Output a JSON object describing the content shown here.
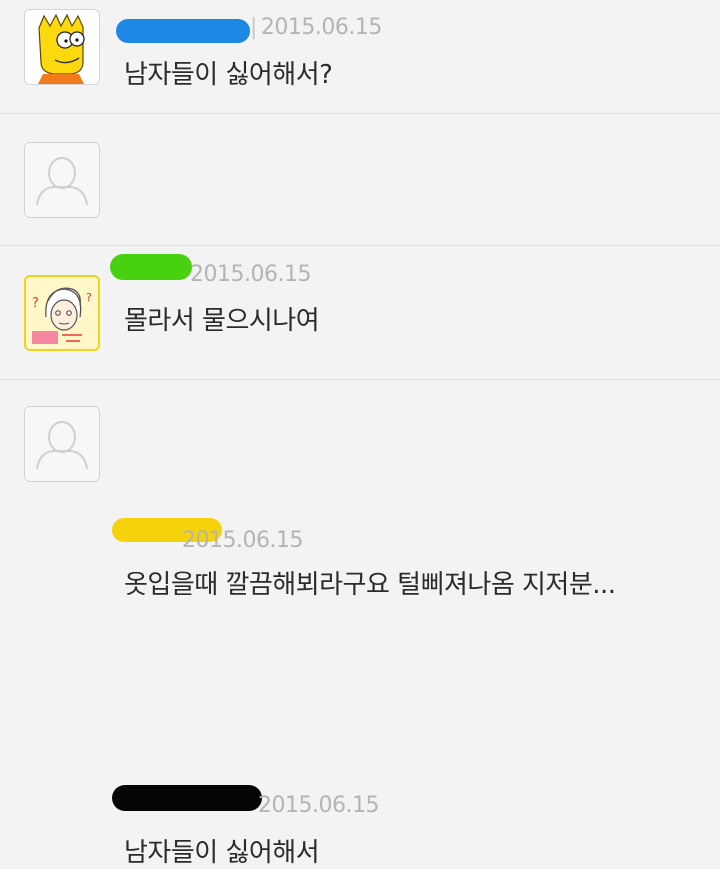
{
  "comments": [
    {
      "date": "2015.06.15",
      "text": "남자들이 싫어해서?",
      "avatar": "bart-simpson-avatar",
      "redact_color": "#1e88e5"
    },
    {
      "date": "2015.06.15",
      "text": "몰라서 물으시나여",
      "avatar": "default-person-icon",
      "redact_color": "#48d10f"
    },
    {
      "date": "2015.06.15",
      "text": "옷입을때 깔끔해뵈라구요 털삐져나옴 지저분...",
      "avatar": "cartoon-face-avatar",
      "redact_color": "#f5d20c"
    },
    {
      "date": "2015.06.15",
      "text": "남자들이 싫어해서",
      "avatar": "default-person-icon",
      "redact_color": "#050505"
    }
  ],
  "colors": {
    "background": "#f3f3f3",
    "divider": "#e1e1e1",
    "date_text": "#b4b4b4",
    "comment_text": "#2b2b2b"
  }
}
